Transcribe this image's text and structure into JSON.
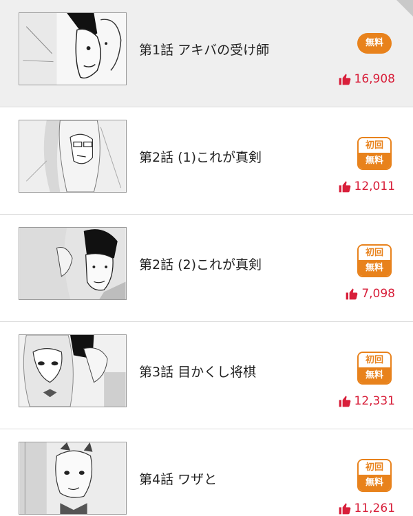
{
  "episodes": [
    {
      "title": "第1話 アキバの受け師",
      "badge_top": "",
      "badge_bottom": "無料",
      "likes": "16,908",
      "thumb_icon": "manga-thumbnail-icon"
    },
    {
      "title": "第2話 (1)これが真剣",
      "badge_top": "初回",
      "badge_bottom": "無料",
      "likes": "12,011",
      "thumb_icon": "manga-thumbnail-icon"
    },
    {
      "title": "第2話 (2)これが真剣",
      "badge_top": "初回",
      "badge_bottom": "無料",
      "likes": "7,098",
      "thumb_icon": "manga-thumbnail-icon"
    },
    {
      "title": "第3話 目かくし将棋",
      "badge_top": "初回",
      "badge_bottom": "無料",
      "likes": "12,331",
      "thumb_icon": "manga-thumbnail-icon"
    },
    {
      "title": "第4話 ワザと",
      "badge_top": "初回",
      "badge_bottom": "無料",
      "likes": "11,261",
      "thumb_icon": "manga-thumbnail-icon"
    }
  ],
  "colors": {
    "badge_orange": "#e8821c",
    "like_red": "#d81f3a",
    "selected_bg": "#efefef",
    "divider": "#dcdcdc"
  },
  "icons": {
    "like": "thumbs-up-icon",
    "corner": "page-corner-fold-icon"
  }
}
